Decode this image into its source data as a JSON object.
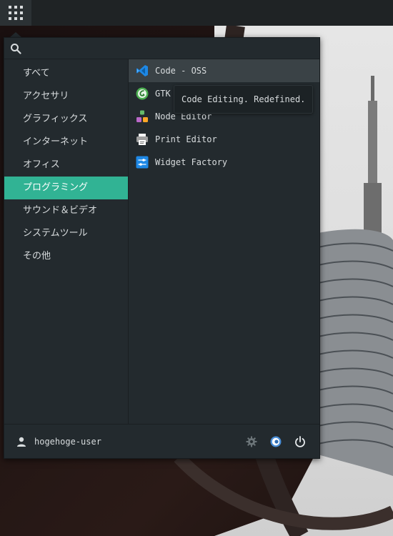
{
  "panel": {
    "apps_button_icon": "app-grid-icon"
  },
  "search": {
    "value": "",
    "placeholder": "",
    "icon": "search-icon"
  },
  "categories": [
    {
      "label": "すべて",
      "active": false
    },
    {
      "label": "アクセサリ",
      "active": false
    },
    {
      "label": "グラフィックス",
      "active": false
    },
    {
      "label": "インターネット",
      "active": false
    },
    {
      "label": "オフィス",
      "active": false
    },
    {
      "label": "プログラミング",
      "active": true
    },
    {
      "label": "サウンド＆ビデオ",
      "active": false
    },
    {
      "label": "システムツール",
      "active": false
    },
    {
      "label": "その他",
      "active": false
    }
  ],
  "apps": [
    {
      "label": "Code - OSS",
      "icon": "vscode-icon",
      "active": true
    },
    {
      "label": "GTK",
      "icon": "gtk-demo-icon",
      "active": false
    },
    {
      "label": "Node Editor",
      "icon": "node-editor-icon",
      "active": false
    },
    {
      "label": "Print Editor",
      "icon": "print-editor-icon",
      "active": false
    },
    {
      "label": "Widget Factory",
      "icon": "widget-factory-icon",
      "active": false
    }
  ],
  "tooltip": {
    "text": "Code Editing. Redefined."
  },
  "footer": {
    "username": "hogehoge-user",
    "buttons": [
      "settings-icon",
      "lock-toggle-icon",
      "power-icon"
    ]
  },
  "colors": {
    "accent": "#31b394",
    "menu_bg": "#232a2e",
    "panel_bg": "#1f2325"
  }
}
